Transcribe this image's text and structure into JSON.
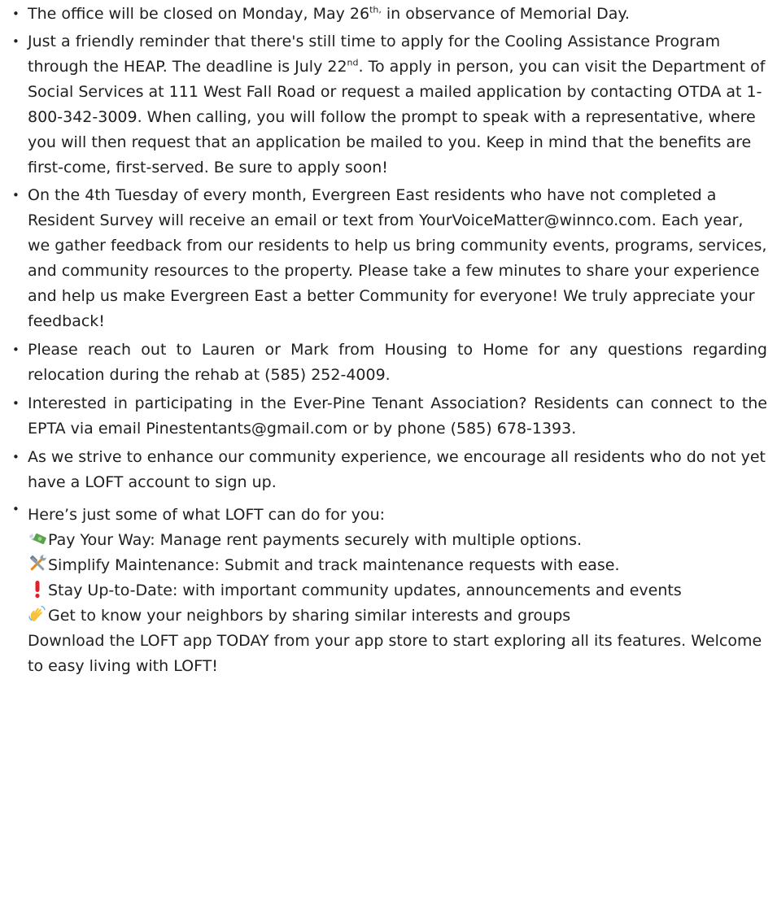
{
  "bullets": {
    "closure": {
      "before": "The office will be closed on Monday, May 26",
      "sup": "th,",
      "after": " in observance of Memorial Day."
    },
    "cooling": {
      "before": "Just a friendly reminder that there's still time to apply for the Cooling Assistance Program through the HEAP. The deadline is July 22",
      "sup": "nd",
      "after": ". To apply in person, you can visit the Department of Social Services at 111 West Fall Road or request a mailed application by contacting OTDA at 1-800-342-3009. When calling, you will follow the prompt to speak with a representative, where you will then request that an application be mailed to you. Keep in mind that the benefits are first-come, first-served. Be sure to apply soon!"
    },
    "survey": "On the 4th Tuesday of every month, Evergreen East residents who have not completed a Resident Survey will receive an email or text from YourVoiceMatter@winnco.com. Each year, we gather feedback from our residents to help us bring community events, programs, services, and community resources to the property.  Please take a few minutes to share your experience and help us make Evergreen East a better Community for everyone! We truly appreciate your feedback!",
    "relocation": "Please reach out to Lauren or Mark from Housing to Home for any questions regarding relocation during the rehab at (585) 252-4009.",
    "tenant_association": "Interested in participating in the Ever-Pine Tenant Association? Residents can connect to the EPTA via email Pinestentants@gmail.com or by phone (585) 678-1393.",
    "loft_signup": "As we strive to enhance our community experience, we encourage all residents who do not yet have a LOFT account to sign up.",
    "loft_features": {
      "intro": "Here’s just some of what LOFT can do for you:",
      "pay": "Pay Your Way: Manage rent payments securely with multiple options.",
      "maintenance": "Simplify Maintenance: Submit and track maintenance requests with ease.",
      "updates": "Stay Up-to-Date: with important community updates, announcements and events",
      "neighbors": "Get to know your neighbors by sharing similar interests and groups",
      "download": "Download the LOFT app TODAY from your app store to start exploring all its features. Welcome to easy living with LOFT!"
    }
  },
  "icons": {
    "pay": "money-with-wings-icon",
    "maintenance": "hammer-and-wrench-icon",
    "updates": "exclamation-icon",
    "neighbors": "waving-hand-icon"
  },
  "colors": {
    "text": "#1f1f1f",
    "money_green": "#5aa34a",
    "exclamation_red": "#e0202a",
    "hand_yellow": "#f5c33b"
  }
}
